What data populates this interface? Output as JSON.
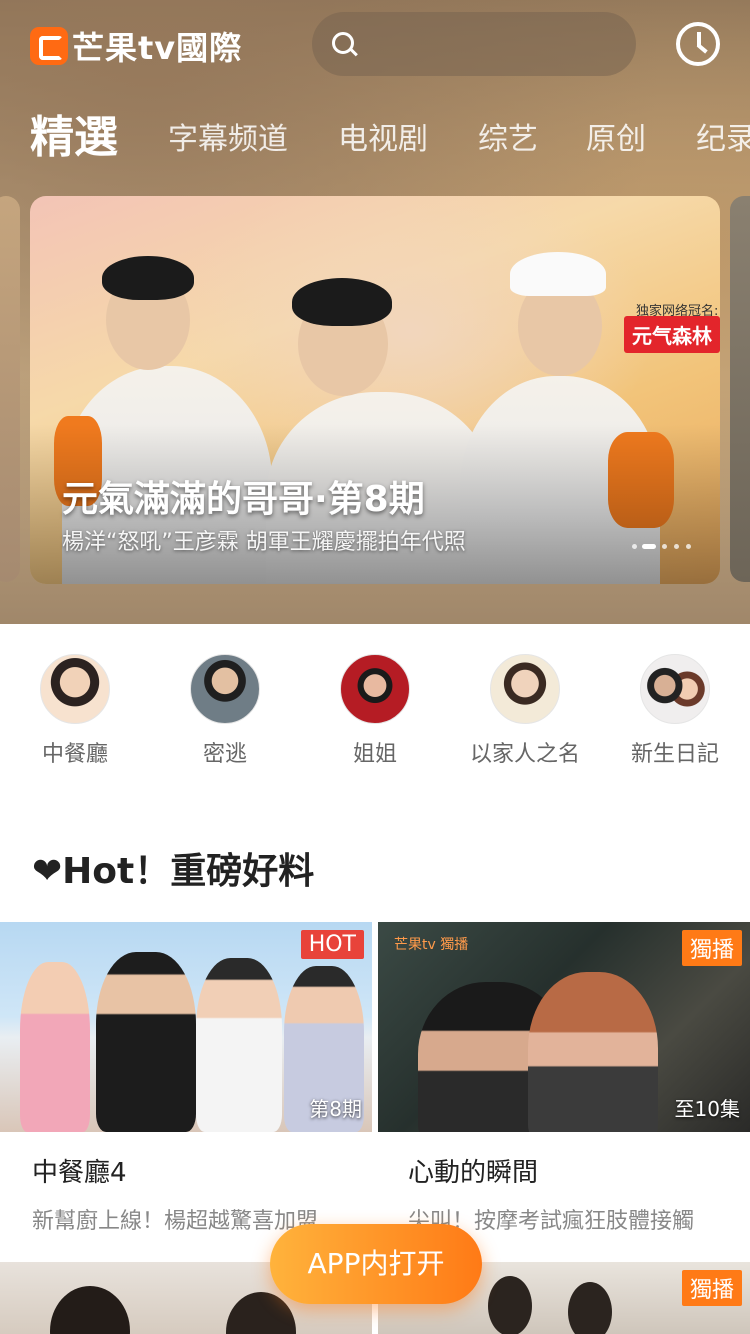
{
  "header": {
    "logo_text": "芒果tv國際",
    "search_placeholder": "",
    "history_icon": "clock-icon"
  },
  "nav": {
    "tabs": [
      {
        "label": "精選",
        "active": true
      },
      {
        "label": "字幕频道",
        "active": false
      },
      {
        "label": "电视剧",
        "active": false
      },
      {
        "label": "综艺",
        "active": false
      },
      {
        "label": "原创",
        "active": false
      },
      {
        "label": "纪录",
        "active": false
      }
    ]
  },
  "banner": {
    "title": "元氣滿滿的哥哥·第8期",
    "subtitle": "楊洋“怒吼”王彦霖 胡軍王耀慶擺拍年代照",
    "sponsor_label": "独家网络冠名:",
    "sponsor_name": "元气森林",
    "slide_count": 4,
    "active_slide": 2
  },
  "stars": [
    {
      "label": "中餐廳"
    },
    {
      "label": "密逃"
    },
    {
      "label": "姐姐"
    },
    {
      "label": "以家人之名"
    },
    {
      "label": "新生日記"
    }
  ],
  "hot_section": {
    "title": "❤Hot！重磅好料",
    "cards": [
      {
        "tag": "HOT",
        "tag_color": "#e8433a",
        "episode": "第8期",
        "title": "中餐廳4",
        "desc": "新幫廚上線！楊超越驚喜加盟"
      },
      {
        "tag": "獨播",
        "tag_color": "#ff7a16",
        "episode": "至10集",
        "title": "心動的瞬間",
        "desc": "尖叫！按摩考試瘋狂肢體接觸",
        "watermark": "芒果tv 獨播"
      },
      {
        "tag": "",
        "tag_color": "#ff7a16"
      },
      {
        "tag": "獨播",
        "tag_color": "#ff7a16"
      }
    ]
  },
  "app_button": {
    "label": "APP内打开"
  },
  "colors": {
    "accent": "#ff7a16",
    "hot_red": "#e8433a",
    "brand_orange": "#ff6a13"
  }
}
